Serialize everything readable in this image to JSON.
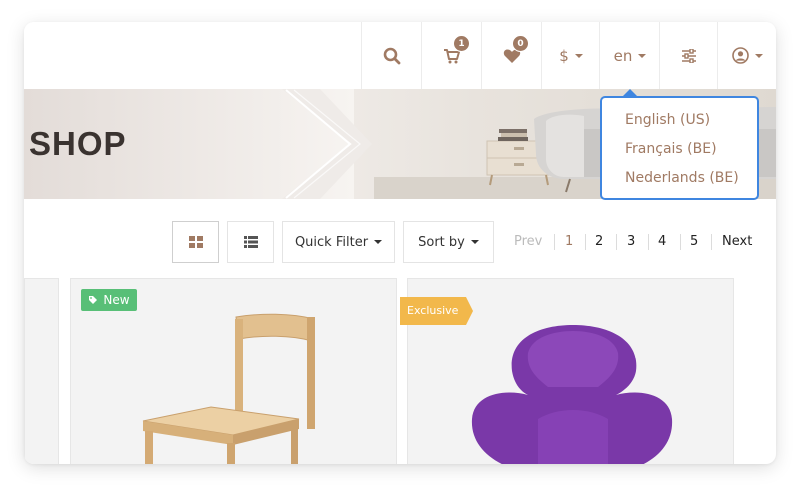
{
  "header": {
    "cart_count": "1",
    "wishlist_count": "0",
    "currency": "$",
    "language": "en"
  },
  "banner": {
    "title": "SHOP"
  },
  "language_menu": {
    "items": [
      "English (US)",
      "Français (BE)",
      "Nederlands (BE)"
    ]
  },
  "toolbar": {
    "quick_filter_label": "Quick Filter",
    "sort_by_label": "Sort by"
  },
  "pagination": {
    "prev": "Prev",
    "pages": [
      "1",
      "2",
      "3",
      "4",
      "5"
    ],
    "next": "Next",
    "current": "1"
  },
  "products": {
    "badge_new": "New",
    "badge_exclusive": "Exclusive"
  },
  "colors": {
    "accent": "#a07a63",
    "new_badge": "#58bf77",
    "exclusive_badge": "#f2b84b",
    "dropdown_border": "#3f86e0"
  }
}
